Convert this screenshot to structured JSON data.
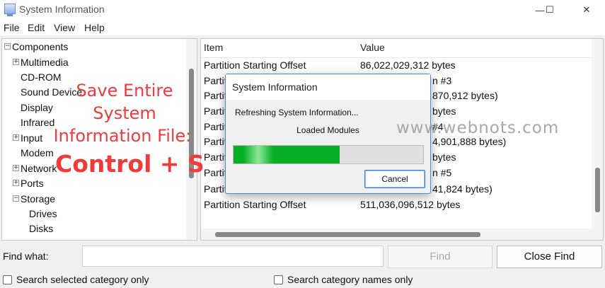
{
  "window": {
    "title": "System Information",
    "minimize_glyph": "—",
    "maximize_glyph": "☐",
    "close_glyph": "✕"
  },
  "menu": [
    "File",
    "Edit",
    "View",
    "Help"
  ],
  "tree": {
    "root": "Components",
    "items": [
      {
        "label": "Multimedia",
        "expandable": true
      },
      {
        "label": "CD-ROM",
        "expandable": false
      },
      {
        "label": "Sound Device",
        "expandable": false
      },
      {
        "label": "Display",
        "expandable": false
      },
      {
        "label": "Infrared",
        "expandable": false
      },
      {
        "label": "Input",
        "expandable": true
      },
      {
        "label": "Modem",
        "expandable": false
      },
      {
        "label": "Network",
        "expandable": true
      },
      {
        "label": "Ports",
        "expandable": true
      },
      {
        "label": "Storage",
        "expandable": true,
        "expanded": true
      },
      {
        "label": "Drives",
        "expandable": false,
        "child": true
      },
      {
        "label": "Disks",
        "expandable": false,
        "child": true
      }
    ]
  },
  "list": {
    "columns": [
      "Item",
      "Value"
    ],
    "rows": [
      {
        "item": "Partition Starting Offset",
        "value": "86,022,029,312 bytes"
      },
      {
        "item": "Partiti",
        "value": "n #3"
      },
      {
        "item": "Partiti",
        "value": "870,912 bytes)"
      },
      {
        "item": "Partiti",
        "value": "bytes"
      },
      {
        "item": "Partiti",
        "value": "#4"
      },
      {
        "item": "Partiti",
        "value": "4,901,888 bytes)"
      },
      {
        "item": "Partiti",
        "value": "bytes"
      },
      {
        "item": "Partiti",
        "value": "n #5"
      },
      {
        "item": "Partiti",
        "value": "41,824 bytes)"
      },
      {
        "item": "Partition Starting Offset",
        "value": "511,036,096,512 bytes"
      }
    ]
  },
  "find": {
    "label": "Find what:",
    "value": "",
    "find_button": "Find",
    "close_button": "Close Find",
    "checkbox_selected": "Search selected category only",
    "checkbox_names": "Search category names only",
    "checkbox_selected_checked": false,
    "checkbox_names_checked": false
  },
  "dialog": {
    "title": "System Information",
    "status": "Refreshing System Information...",
    "substatus": "Loaded Modules",
    "progress_percent": 56,
    "progress_color": "#06b025",
    "cancel": "Cancel"
  },
  "overlay": {
    "line1": "Save Entire",
    "line2": "System",
    "line3": "Information File:",
    "line4": "Control + S",
    "color": "#ef3b3b"
  },
  "watermark": "www.webnots.com"
}
